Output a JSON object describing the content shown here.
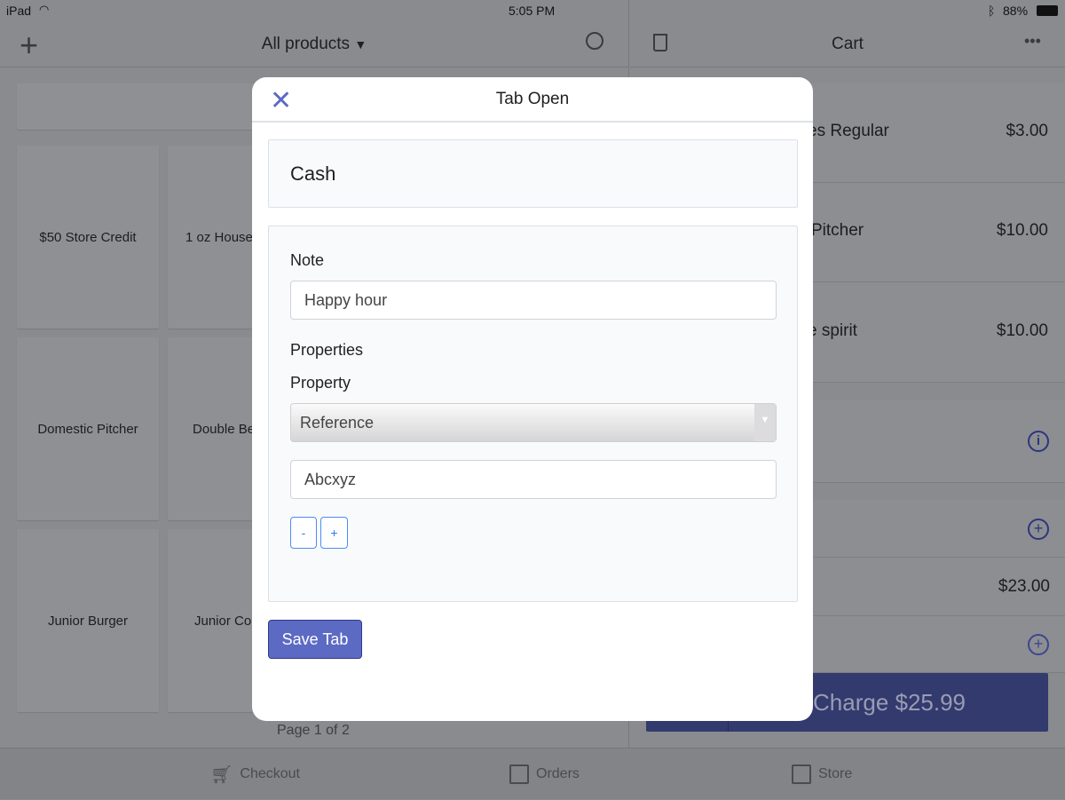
{
  "status": {
    "device": "iPad",
    "time": "5:05 PM",
    "battery": "88%"
  },
  "products": {
    "title": "All products",
    "page": "Page 1 of 2",
    "tiles": [
      "$50 Store Credit",
      "1 oz House",
      "Domestic Pitcher",
      "Double Be",
      "Junior Burger",
      "Junior Co"
    ]
  },
  "cart": {
    "title": "Cart",
    "items": [
      {
        "name": "es Regular",
        "price": "$3.00"
      },
      {
        "name": "Pitcher",
        "price": "$10.00"
      },
      {
        "name": "e spirit",
        "price": "$10.00"
      }
    ],
    "subtotal": "$23.00",
    "charge": "Charge $25.99"
  },
  "tabs": [
    "Checkout",
    "Orders",
    "Store"
  ],
  "modal": {
    "title": "Tab Open",
    "payment": "Cash",
    "note_label": "Note",
    "note_value": "Happy hour",
    "properties_label": "Properties",
    "property_label": "Property",
    "property_select": "Reference",
    "property_value": "Abcxyz",
    "minus": "-",
    "plus": "+",
    "save": "Save Tab"
  },
  "colors": {
    "accent": "#5c6ac4",
    "charge": "#323a6e",
    "link": "#2f7af5"
  }
}
